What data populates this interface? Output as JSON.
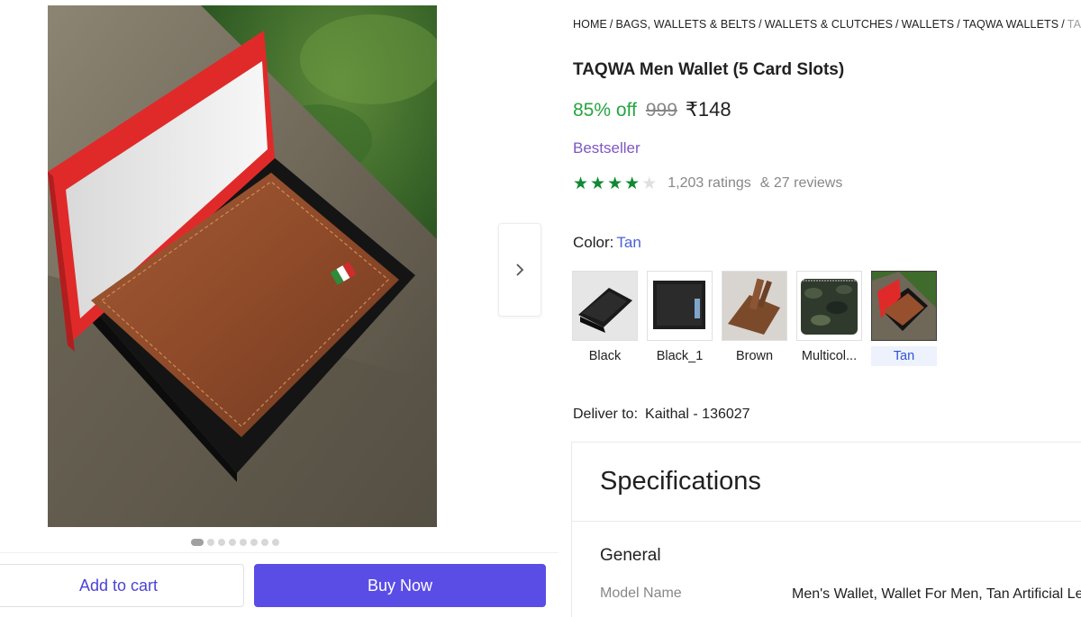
{
  "breadcrumb": [
    "HOME",
    "BAGS, WALLETS & BELTS",
    "WALLETS & CLUTCHES",
    "WALLETS",
    "TAQWA WALLETS",
    "TAQWA"
  ],
  "product": {
    "title": "TAQWA Men Wallet (5 Card Slots)",
    "discount": "85% off",
    "mrp": "999",
    "price": "₹148",
    "badge": "Bestseller",
    "rating": 4,
    "rating_max": 5,
    "ratings_count": "1,203 ratings",
    "reviews_count": "& 27 reviews"
  },
  "gallery": {
    "image_count": 8,
    "active_index": 0,
    "next_icon": "chevron-right-icon"
  },
  "color": {
    "label": "Color:",
    "selected": "Tan",
    "options": [
      "Black",
      "Black_1",
      "Brown",
      "Multicol...",
      "Tan"
    ]
  },
  "delivery": {
    "label": "Deliver to:",
    "location": "Kaithal - 136027"
  },
  "actions": {
    "add_to_cart": "Add to cart",
    "buy_now": "Buy Now"
  },
  "specifications": {
    "title": "Specifications",
    "group": "General",
    "rows": [
      {
        "key": "Model Name",
        "value": "Men's Wallet, Wallet For Men, Tan Artificial Leather"
      }
    ]
  },
  "colors": {
    "accent": "#5a4de6",
    "discount_green": "#26a541",
    "star_green": "#108934",
    "badge_purple": "#7e57c2",
    "link_blue": "#4a5fd8"
  }
}
